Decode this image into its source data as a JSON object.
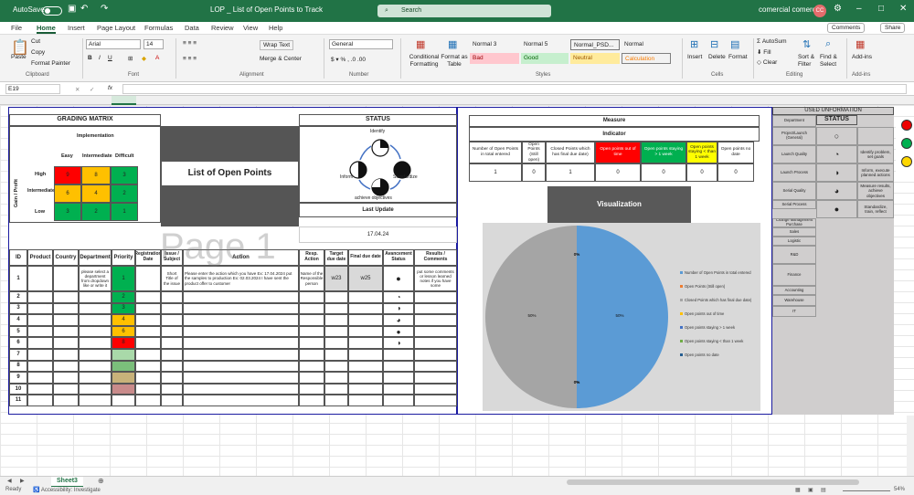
{
  "titlebar": {
    "autosave": "AutoSave",
    "file_title": "LOP _ List of Open Points to Track",
    "search_placeholder": "Search",
    "user_name": "comercial comercial",
    "user_initials": "CC"
  },
  "menu": [
    "File",
    "Home",
    "Insert",
    "Page Layout",
    "Formulas",
    "Data",
    "Review",
    "View",
    "Help"
  ],
  "active_menu": "Home",
  "top_buttons": {
    "comments": "Comments",
    "share": "Share"
  },
  "ribbon": {
    "clipboard": {
      "paste": "Paste",
      "cut": "Cut",
      "copy": "Copy",
      "format_painter": "Format Painter",
      "label": "Clipboard"
    },
    "font": {
      "name": "Arial",
      "size": "14",
      "label": "Font"
    },
    "alignment": {
      "wrap": "Wrap Text",
      "merge": "Merge & Center",
      "label": "Alignment"
    },
    "number": {
      "format": "General",
      "label": "Number"
    },
    "styles_group": {
      "conditional": "Conditional Formatting",
      "format_table": "Format as Table",
      "label": "Styles"
    },
    "styles": [
      {
        "name": "Normal 3",
        "bg": "#ffffff",
        "fg": "#222222"
      },
      {
        "name": "Normal 5",
        "bg": "#ffffff",
        "fg": "#222222"
      },
      {
        "name": "Normal_PSD...",
        "bg": "#ffffff",
        "fg": "#222222"
      },
      {
        "name": "Normal",
        "bg": "#ffffff",
        "fg": "#222222"
      },
      {
        "name": "Bad",
        "bg": "#ffc7ce",
        "fg": "#9c0006"
      },
      {
        "name": "Good",
        "bg": "#c6efce",
        "fg": "#006100"
      },
      {
        "name": "Neutral",
        "bg": "#ffeb9c",
        "fg": "#9c5700"
      },
      {
        "name": "Calculation",
        "bg": "#f2f2f2",
        "fg": "#fa7d00"
      }
    ],
    "cells": {
      "insert": "Insert",
      "delete": "Delete",
      "format": "Format",
      "label": "Cells"
    },
    "editing": {
      "autosum": "AutoSum",
      "fill": "Fill",
      "clear": "Clear",
      "sort": "Sort & Filter",
      "find": "Find & Select",
      "label": "Editing"
    },
    "addins": {
      "label": "Add-ins",
      "btn": "Add-ins"
    }
  },
  "formula_bar": {
    "namebox": "E19",
    "fx": "fx",
    "value": ""
  },
  "grading": {
    "title": "GRADING MATRIX",
    "implementation": "Implementation",
    "cols": [
      "Easy",
      "Intermediate",
      "Difficult"
    ],
    "rows": [
      {
        "label": "High",
        "cells": [
          {
            "v": "9",
            "c": "#ff0000"
          },
          {
            "v": "8",
            "c": "#ffc000"
          },
          {
            "v": "3",
            "c": "#00b050"
          }
        ]
      },
      {
        "label": "Intermediate",
        "cells": [
          {
            "v": "6",
            "c": "#ffc000"
          },
          {
            "v": "4",
            "c": "#ffc000"
          },
          {
            "v": "2",
            "c": "#00b050"
          }
        ]
      },
      {
        "label": "Low",
        "cells": [
          {
            "v": "3",
            "c": "#00b050"
          },
          {
            "v": "2",
            "c": "#00b050"
          },
          {
            "v": "1",
            "c": "#00b050"
          }
        ]
      }
    ],
    "side_label": "Gain / Profit"
  },
  "list_title": "List of Open Points",
  "status_panel": {
    "title": "STATUS",
    "steps": [
      "Identify",
      "Inform",
      "Standardize",
      "achieve objectives"
    ],
    "last_update_label": "Last Update",
    "last_update": "17.04.24"
  },
  "watermark": "Page 1",
  "table": {
    "headers": [
      "ID",
      "Product",
      "Country",
      "Department",
      "Priority",
      "Registration Date",
      "Issue / Subject",
      "Action",
      "Resp. Action",
      "Target due date",
      "Final due date",
      "Avancement Status",
      "Results / Comments"
    ],
    "row1": {
      "id": "1",
      "department": "please select a department from dropdown like or write it",
      "priority": "1",
      "issue": "Short Title of the issue",
      "action": "Please enter the action which you have Ex: 17.04.2024 put the samples to production Ex: 02.03.2024 I have sent the product offer to customer",
      "resp": "Name of the Responsible person",
      "target": "w23",
      "final": "w25",
      "results": "put some comments or lesson learned notes if you have some"
    },
    "rows": [
      {
        "id": "2",
        "priority": "2",
        "pc": "#00b050",
        "status": "◔"
      },
      {
        "id": "3",
        "priority": "3",
        "pc": "#00b050",
        "status": "◑"
      },
      {
        "id": "4",
        "priority": "4",
        "pc": "#ffc000",
        "status": "◕"
      },
      {
        "id": "5",
        "priority": "6",
        "pc": "#ffc000",
        "status": "●"
      },
      {
        "id": "6",
        "priority": "8",
        "pc": "#ff0000",
        "status": "◑"
      },
      {
        "id": "7",
        "priority": "",
        "pc": "#a9d9a9",
        "status": ""
      },
      {
        "id": "8",
        "priority": "",
        "pc": "#7bbf7b",
        "status": ""
      },
      {
        "id": "9",
        "priority": "",
        "pc": "#c8b27a",
        "status": ""
      },
      {
        "id": "10",
        "priority": "",
        "pc": "#c98b8b",
        "status": ""
      },
      {
        "id": "11",
        "priority": "",
        "pc": "#ffffff",
        "status": ""
      }
    ],
    "row1_status": "●"
  },
  "measure": {
    "title": "Measure",
    "indicator": "Indicator",
    "cols": [
      {
        "label": "Number of Open Points in total entered",
        "bg": "#ffffff",
        "fg": "#222222",
        "value": "1"
      },
      {
        "label": "Open Points (Still open)",
        "bg": "#ffffff",
        "fg": "#222222",
        "value": "0"
      },
      {
        "label": "Closed Points which has final due date)",
        "bg": "#ffffff",
        "fg": "#222222",
        "value": "1"
      },
      {
        "label": "Open points out of time",
        "bg": "#ff0000",
        "fg": "#ffffff",
        "value": "0"
      },
      {
        "label": "Open points staying > 1 week",
        "bg": "#00b050",
        "fg": "#ffffff",
        "value": "0"
      },
      {
        "label": "Open points staying < than 1 week",
        "bg": "#ffff00",
        "fg": "#222222",
        "value": "0"
      },
      {
        "label": "Open points no date",
        "bg": "#ffffff",
        "fg": "#222222",
        "value": "0"
      }
    ],
    "visualization": "Visualization"
  },
  "chart_data": {
    "type": "pie",
    "categories": [
      "Number of Open Points in total entered",
      "Open Points (Still open)",
      "Closed Points which has final due date)",
      "Open points out of time",
      "Open points staying > 1 week",
      "Open points staying < than 1 week",
      "Open points no date"
    ],
    "values": [
      1,
      0,
      1,
      0,
      0,
      0,
      0
    ],
    "slice_labels": [
      "50%",
      "0%",
      "50%",
      "0%",
      "0%",
      "0%",
      "0%"
    ],
    "legend": "right",
    "colors": [
      "#5b9bd5",
      "#ed7d31",
      "#a5a5a5",
      "#ffc000",
      "#4472c4",
      "#70ad47",
      "#255e91"
    ]
  },
  "used": {
    "title": "USED UNFORMATION",
    "status": "STATUS",
    "departments": [
      "Department",
      "Project/Launch (General)",
      "Launch Quality",
      "Launch Process",
      "Serial Quality",
      "Serial Process",
      "Change Management Purchase",
      "Sales",
      "Logistic",
      "R&D",
      "Finance",
      "Accounting",
      "Warehouse",
      "IT"
    ],
    "symbols": [
      {
        "s": "○",
        "d": ""
      },
      {
        "s": "◔",
        "d": "Identify problem, set goals"
      },
      {
        "s": "◑",
        "d": "Inform, execute planned actions"
      },
      {
        "s": "◕",
        "d": "Measure results, achieve objectives"
      },
      {
        "s": "●",
        "d": "Standardize, train, reflect"
      }
    ]
  },
  "sheet_tab": "Sheet3",
  "status_bar": {
    "ready": "Ready",
    "accessibility": "Accessibility: Investigate",
    "zoom": "54%"
  }
}
